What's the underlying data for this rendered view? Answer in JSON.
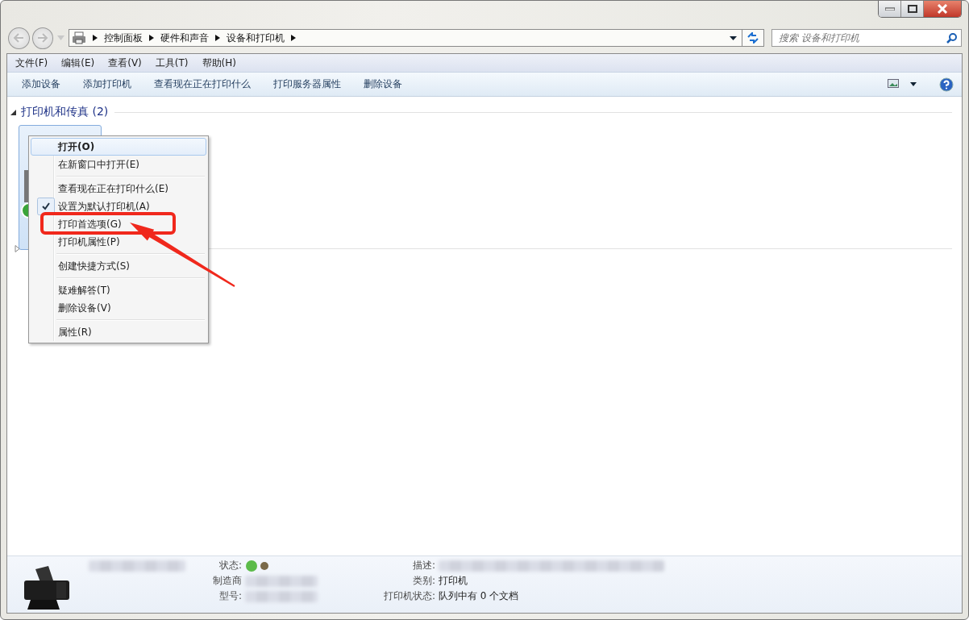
{
  "window": {
    "breadcrumb": [
      "控制面板",
      "硬件和声音",
      "设备和打印机"
    ],
    "search": {
      "placeholder": "搜索 设备和打印机"
    }
  },
  "menu_bar": [
    "文件(F)",
    "编辑(E)",
    "查看(V)",
    "工具(T)",
    "帮助(H)"
  ],
  "toolbar": [
    "添加设备",
    "添加打印机",
    "查看现在正在打印什么",
    "打印服务器属性",
    "删除设备"
  ],
  "group": {
    "title": "打印机和传真 (2)",
    "expanded": true
  },
  "context_menu": [
    {
      "kind": "item",
      "label": "打开(O)",
      "bold": true,
      "selected": true,
      "checked": false
    },
    {
      "kind": "item",
      "label": "在新窗口中打开(E)",
      "bold": false,
      "selected": false,
      "checked": false
    },
    {
      "kind": "separator"
    },
    {
      "kind": "item",
      "label": "查看现在正在打印什么(E)",
      "bold": false,
      "selected": false,
      "checked": false
    },
    {
      "kind": "item",
      "label": "设置为默认打印机(A)",
      "bold": false,
      "selected": false,
      "checked": true
    },
    {
      "kind": "item",
      "label": "打印首选项(G)",
      "bold": false,
      "selected": false,
      "checked": false,
      "annotated": true
    },
    {
      "kind": "item",
      "label": "打印机属性(P)",
      "bold": false,
      "selected": false,
      "checked": false
    },
    {
      "kind": "separator"
    },
    {
      "kind": "item",
      "label": "创建快捷方式(S)",
      "bold": false,
      "selected": false,
      "checked": false
    },
    {
      "kind": "separator"
    },
    {
      "kind": "item",
      "label": "疑难解答(T)",
      "bold": false,
      "selected": false,
      "checked": false
    },
    {
      "kind": "item",
      "label": "删除设备(V)",
      "bold": false,
      "selected": false,
      "checked": false
    },
    {
      "kind": "separator"
    },
    {
      "kind": "item",
      "label": "属性(R)",
      "bold": false,
      "selected": false,
      "checked": false
    }
  ],
  "details": {
    "left": [
      {
        "label": "状态:",
        "kind": "status"
      },
      {
        "label": "制造商",
        "kind": "blurred"
      },
      {
        "label": "型号:",
        "kind": "blurred"
      }
    ],
    "right": [
      {
        "label": "描述:",
        "kind": "blurred"
      },
      {
        "label": "类别:",
        "value": "打印机",
        "kind": "text"
      },
      {
        "label": "打印机状态:",
        "value": "队列中有 0 个文档",
        "kind": "text"
      }
    ]
  }
}
